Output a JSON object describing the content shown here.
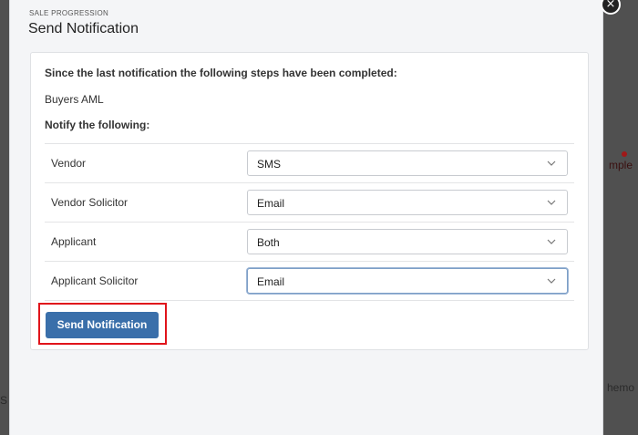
{
  "background": {
    "peek_right_top": "mple",
    "peek_right_bottom": "hemo",
    "peek_left_bottom": "S"
  },
  "modal": {
    "eyebrow": "SALE PROGRESSION",
    "title": "Send Notification",
    "close_glyph": "×"
  },
  "panel": {
    "intro": "Since the last notification the following steps have been completed:",
    "completed_step": "Buyers AML",
    "notify_heading": "Notify the following:",
    "rows": [
      {
        "label": "Vendor",
        "value": "SMS"
      },
      {
        "label": "Vendor Solicitor",
        "value": "Email"
      },
      {
        "label": "Applicant",
        "value": "Both"
      },
      {
        "label": "Applicant Solicitor",
        "value": "Email"
      }
    ],
    "submit_label": "Send Notification"
  },
  "colors": {
    "primary_button": "#3a6faa",
    "highlight_border": "#e0141b"
  },
  "icons": {
    "select_arrow": "chevron-down-icon",
    "close": "close-icon"
  }
}
